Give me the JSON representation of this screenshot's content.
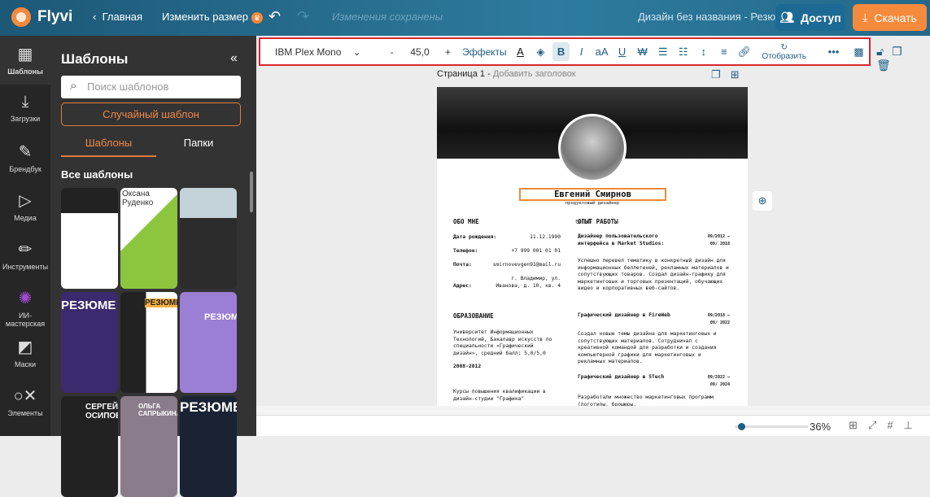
{
  "header": {
    "logo": "Flyvi",
    "home": "Главная",
    "resize": "Изменить размер",
    "status": "Изменения сохранены",
    "doc_title": "Дизайн без названия - Резюме",
    "share": "Доступ",
    "download": "Скачать"
  },
  "rail": [
    {
      "label": "Шаблоны",
      "icon": "layout-icon"
    },
    {
      "label": "Загрузки",
      "icon": "upload-icon"
    },
    {
      "label": "Брендбук",
      "icon": "brandbook-icon"
    },
    {
      "label": "Медиа",
      "icon": "media-icon"
    },
    {
      "label": "Инструменты",
      "icon": "pencil-icon"
    },
    {
      "label": "ИИ-мастерская",
      "icon": "ai-icon"
    },
    {
      "label": "Маски",
      "icon": "mask-icon"
    },
    {
      "label": "Элементы",
      "icon": "elements-icon"
    }
  ],
  "panel": {
    "title": "Шаблоны",
    "search_placeholder": "Поиск шаблонов",
    "random": "Случайный шаблон",
    "tabs": [
      "Шаблоны",
      "Папки"
    ],
    "section": "Все шаблоны",
    "thumbs": [
      "",
      "Оксана Руденко",
      "",
      "РЕЗЮМЕ",
      "РЕЗЮМЕ",
      "РЕЗЮМЕ",
      "СЕРГЕЙ ОСИПОВ",
      "ОЛЬГА САПРЫКИНА",
      "РЕЗЮМЕ"
    ]
  },
  "toolbar": {
    "font": "IBM Plex Mono",
    "minus": "-",
    "size": "45,0",
    "plus": "+",
    "effects": "Эффекты",
    "flip": "Отобразить"
  },
  "canvas": {
    "page_label": "Страница 1 -",
    "add_title": "Добавить заголовок",
    "zoom": "36%",
    "zoom_fraction": 0.05
  },
  "resume": {
    "name": "Евгений Смирнов",
    "role": "продуктовый дизайнер",
    "about_h": "ОБО МНЕ",
    "about": [
      [
        "Дата рождения:",
        "11.12.1990"
      ],
      [
        "Телефон:",
        "+7 999 001 01 01"
      ],
      [
        "Почта:",
        "smirnovevgen91@mail.ru"
      ],
      [
        "Адрес:",
        "г. Владимир, ул. Иванова, д. 10, кв. 4"
      ]
    ],
    "edu_h": "ОБРАЗОВАНИЕ",
    "edu1": "Университет Информационных Технологий, Бакалавр искусств по специальности «Графический дизайн», средний балл: 5,0/5,0",
    "edu1_years": "2008-2012",
    "edu2": "Курсы повышения квалификации в дизайн-студии \"Графика\"",
    "exp_h": "ОПЫТ РАБОТЫ",
    "jobs": [
      {
        "title": "Дизайнер пользовательского интерфейса в Market Studios:",
        "dates": "09/2012 – 09/ 2018",
        "desc": "Успешно перевел тематику в конкретный дизайн для информационных беллетеней, рекламных материалов и сопутствующих товаров. Создал дизайн-графику для маркетинговых и торговых презентаций, обучающих видео и корпоративных веб-сайтов."
      },
      {
        "title": "Графический дизайнер в FireWeb",
        "dates": "09/2018 – 09/ 2022",
        "desc": "Создал новые темы дизайна для маркетинговых и сопутствующих материалов. Сотрудничал с креативной командой для разработки и создания компьютерной графики для маркетинговых и рекламных материалов."
      },
      {
        "title": "Графический дизайнер в 5Tech",
        "dates": "09/2022 – 09/ 2024",
        "desc": "Разработали множество маркетинговых программ (логотипы, брошюры,"
      }
    ]
  }
}
